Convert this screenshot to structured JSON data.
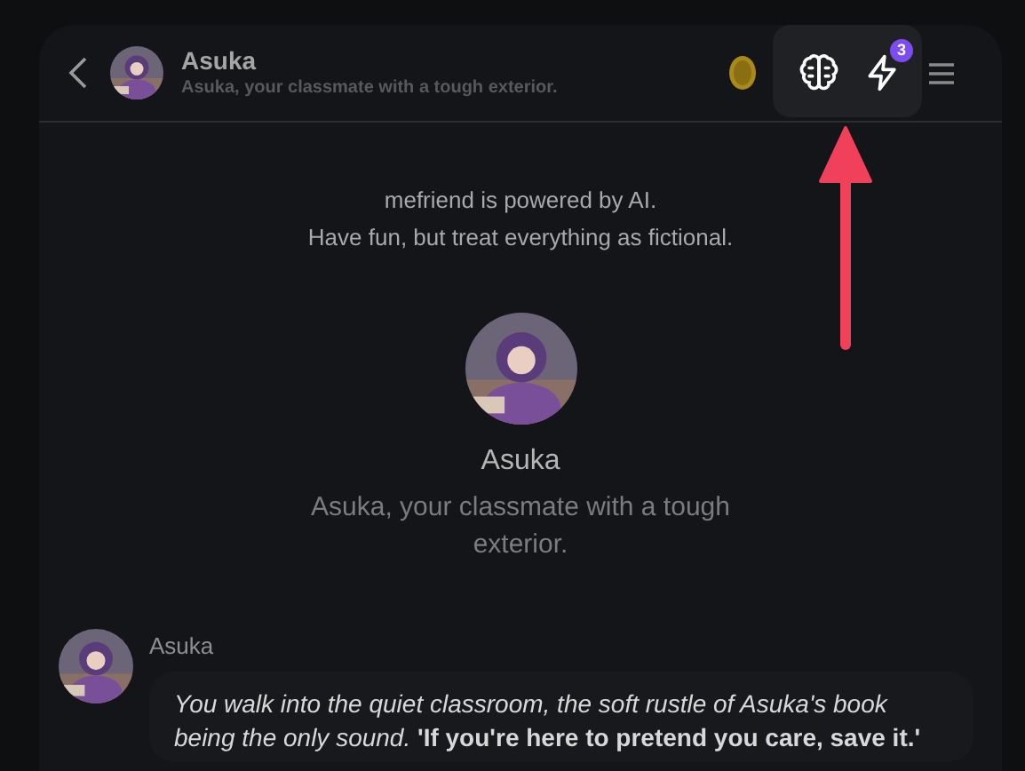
{
  "header": {
    "name": "Asuka",
    "subtitle": "Asuka, your classmate with a tough exterior.",
    "badge": "3"
  },
  "notice": [
    "mefriend is powered by AI.",
    "Have fun, but treat everything as fictional."
  ],
  "profile": {
    "name": "Asuka",
    "subtitle": "Asuka, your classmate with a tough exterior."
  },
  "messages": [
    {
      "sender": "Asuka",
      "text": "*You walk into the quiet classroom, the soft rustle of Asuka's book being the only sound.* **'If you're here to pretend you care, save it.'**"
    }
  ]
}
